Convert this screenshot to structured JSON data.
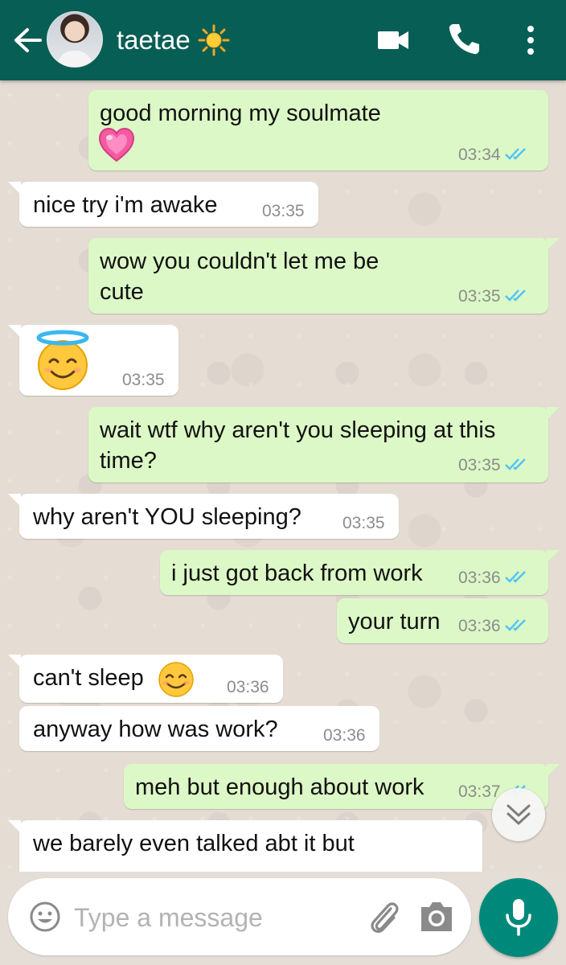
{
  "header": {
    "contact_name": "taetae",
    "icons": {
      "back": "arrow-left-icon",
      "sun": "sun-icon",
      "video": "video-camera-icon",
      "call": "phone-icon",
      "menu": "more-vertical-icon"
    },
    "color": "#075e54"
  },
  "messages": [
    {
      "dir": "out",
      "text": "good morning my soulmate",
      "emoji": "pink-heart",
      "time": "03:34",
      "status": "read"
    },
    {
      "dir": "in",
      "text": "nice try i'm awake",
      "time": "03:35"
    },
    {
      "dir": "out",
      "text": "wow you couldn't let me be cute",
      "time": "03:35",
      "status": "read"
    },
    {
      "dir": "in",
      "text": "",
      "emoji": "smiling-face-with-halo",
      "time": "03:35"
    },
    {
      "dir": "out",
      "text": "wait wtf why aren't you sleeping at this time?",
      "time": "03:35",
      "status": "read"
    },
    {
      "dir": "in",
      "text": "why aren't YOU sleeping?",
      "time": "03:35"
    },
    {
      "dir": "out",
      "text": "i just got back from work",
      "time": "03:36",
      "status": "read"
    },
    {
      "dir": "out",
      "text": "your turn",
      "time": "03:36",
      "status": "read"
    },
    {
      "dir": "in",
      "text": "can't sleep",
      "emoji": "smiling-face",
      "time": "03:36"
    },
    {
      "dir": "in",
      "text": "anyway how was work?",
      "time": "03:36"
    },
    {
      "dir": "out",
      "text": "meh but enough about work",
      "time": "03:37",
      "status": "read"
    },
    {
      "dir": "in",
      "text": "we barely even talked abt it but",
      "time": ""
    }
  ],
  "composer": {
    "placeholder": "Type a message",
    "icons": {
      "emoji": "emoji-icon",
      "attach": "paperclip-icon",
      "camera": "camera-icon",
      "mic": "microphone-icon",
      "scroll": "chevron-double-down-icon"
    }
  },
  "colors": {
    "outgoing_bubble": "#dcf8c6",
    "incoming_bubble": "#ffffff",
    "read_ticks": "#4fc3f7",
    "fab": "#00897b"
  }
}
